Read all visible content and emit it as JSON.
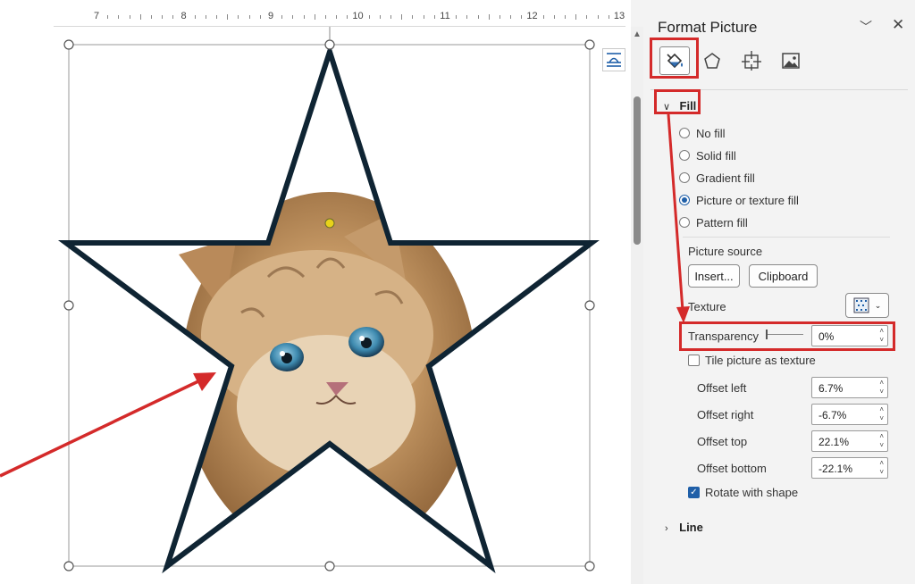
{
  "ruler": {
    "numbers": [
      "7",
      "8",
      "9",
      "10",
      "11",
      "12",
      "13"
    ]
  },
  "panel": {
    "title": "Format Picture",
    "tabs": [
      {
        "name": "Fill & Line",
        "icon": "paint-bucket-icon"
      },
      {
        "name": "Effects",
        "icon": "pentagon-icon"
      },
      {
        "name": "Layout & Properties",
        "icon": "size-properties-icon"
      },
      {
        "name": "Picture",
        "icon": "picture-icon"
      }
    ],
    "fill": {
      "header": "Fill",
      "options": [
        {
          "label": "No fill",
          "checked": false
        },
        {
          "label": "Solid fill",
          "checked": false
        },
        {
          "label": "Gradient fill",
          "checked": false
        },
        {
          "label": "Picture or texture fill",
          "checked": true
        },
        {
          "label": "Pattern fill",
          "checked": false
        }
      ],
      "picture_source_label": "Picture source",
      "insert_button": "Insert...",
      "clipboard_button": "Clipboard",
      "texture_label": "Texture",
      "transparency_label": "Transparency",
      "transparency_value": "0%",
      "tile_label": "Tile picture as texture",
      "offsets": [
        {
          "label": "Offset left",
          "value": "6.7%"
        },
        {
          "label": "Offset right",
          "value": "-6.7%"
        },
        {
          "label": "Offset top",
          "value": "22.1%"
        },
        {
          "label": "Offset bottom",
          "value": "-22.1%"
        }
      ],
      "rotate_label": "Rotate with shape",
      "rotate_checked": true
    },
    "line": {
      "header": "Line"
    }
  },
  "colors": {
    "accent": "#1f5fa8",
    "highlight": "#d42a2a",
    "star_outline": "#0f2433",
    "handle_yellow": "#e8d21a"
  }
}
